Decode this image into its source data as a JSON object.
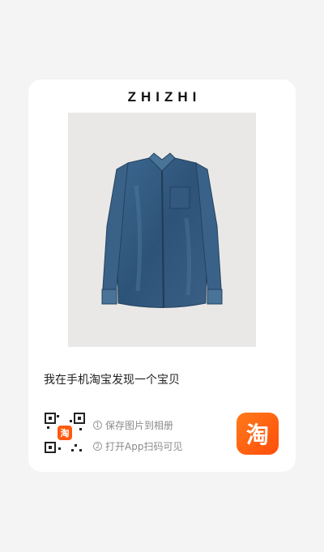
{
  "card": {
    "brand": "ZHIZHI",
    "caption": "我在手机淘宝发现一个宝贝"
  },
  "steps": [
    {
      "num": "1",
      "text": "保存图片到相册"
    },
    {
      "num": "2",
      "text": "打开App扫码可见"
    }
  ],
  "app_badge": {
    "glyph": "淘"
  },
  "qr": {
    "center_glyph": "淘"
  },
  "colors": {
    "background": "#f4f4f4",
    "card": "#ffffff",
    "accent": "#ff5a10",
    "denim": "#2f5478"
  }
}
